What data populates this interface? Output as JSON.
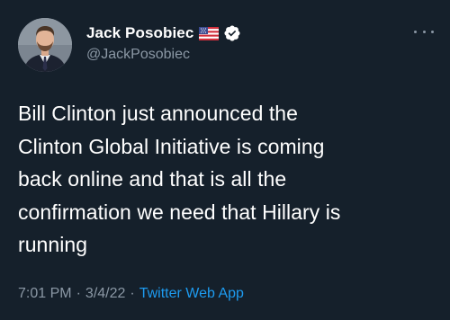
{
  "tweet": {
    "author": {
      "display_name": "Jack Posobiec",
      "handle": "@JackPosobiec",
      "flag_icon": "us-flag-icon",
      "verified_icon": "verified-badge-icon",
      "verified_color": "#ffffff"
    },
    "text": "Bill Clinton just announced the\nClinton Global Initiative is coming\nback online and that is all the\nconfirmation we need that Hillary is\nrunning",
    "time": "7:01 PM",
    "date": "3/4/22",
    "separator": "·",
    "source": "Twitter Web App",
    "colors": {
      "background": "#15202b",
      "text": "#ffffff",
      "secondary": "#8b98a5",
      "link": "#1d9bf0"
    }
  }
}
